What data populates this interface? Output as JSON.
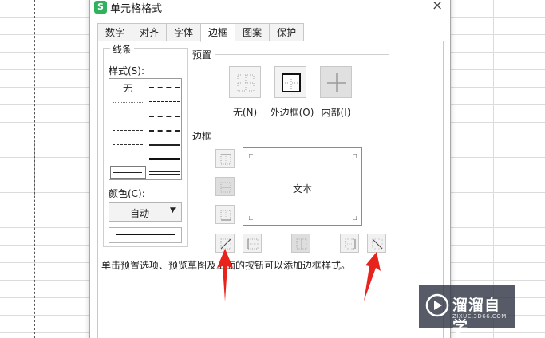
{
  "dialog": {
    "title": "单元格格式",
    "app_icon_letter": "S",
    "close_glyph": "×"
  },
  "tabs": [
    {
      "label": "数字"
    },
    {
      "label": "对齐"
    },
    {
      "label": "字体"
    },
    {
      "label": "边框",
      "active": true
    },
    {
      "label": "图案"
    },
    {
      "label": "保护"
    }
  ],
  "line_group": {
    "title": "线条",
    "style_label": "样式(S):",
    "style_none": "无",
    "color_label": "颜色(C):",
    "color_value": "自动"
  },
  "presets": {
    "title": "预置",
    "items": [
      {
        "label": "无(N)"
      },
      {
        "label": "外边框(O)"
      },
      {
        "label": "内部(I)"
      }
    ]
  },
  "border": {
    "title": "边框",
    "preview_text": "文本"
  },
  "hint": "单击预置选项、预览草图及上面的按钮可以添加边框样式。",
  "watermark": {
    "name": "溜溜自学",
    "url": "ZIXUE.3D66.COM"
  },
  "colors": {
    "accent_arrow": "#e8231c",
    "app_icon": "#2fb15d"
  },
  "icons": [
    "close-icon",
    "app-logo-icon",
    "border-top-icon",
    "border-middle-horizontal-icon",
    "border-bottom-icon",
    "diagonal-up-icon",
    "border-left-icon",
    "border-center-vertical-icon",
    "border-right-icon",
    "diagonal-down-icon",
    "watermark-logo-icon"
  ]
}
